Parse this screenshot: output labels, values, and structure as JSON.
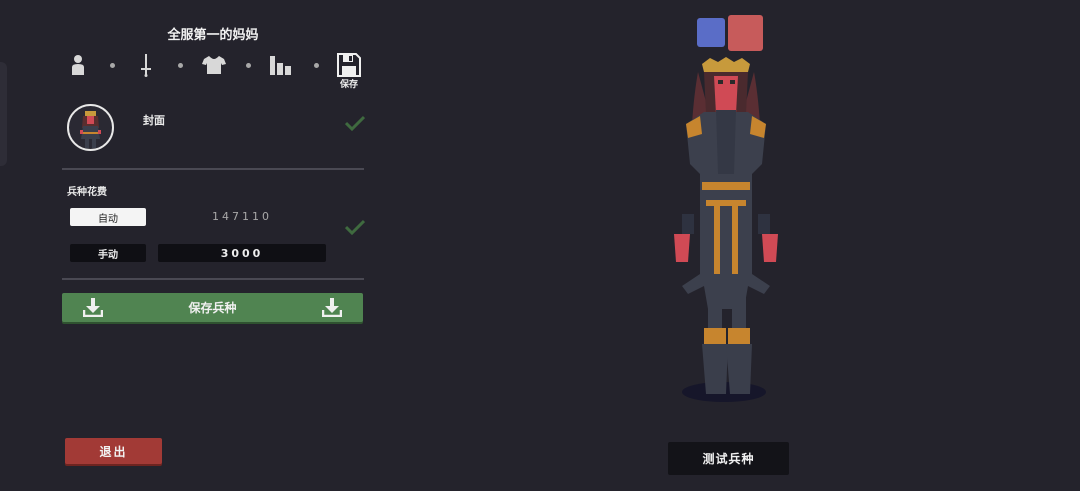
{
  "unit_name": "全服第一的妈妈",
  "editor_tabs": {
    "items": [
      {
        "icon": "person-icon",
        "label": ""
      },
      {
        "icon": "sword-icon",
        "label": ""
      },
      {
        "icon": "shirt-icon",
        "label": ""
      },
      {
        "icon": "stats-bars-icon",
        "label": ""
      },
      {
        "icon": "floppy-disk-icon",
        "label": "保存"
      }
    ],
    "save_label": "保存"
  },
  "cover": {
    "label": "封面",
    "checked": true
  },
  "cost": {
    "section_label": "兵种花费",
    "auto_label": "自动",
    "auto_value": "147110",
    "manual_label": "手动",
    "manual_value": "3000",
    "mode": "manual"
  },
  "save_unit_label": "保存兵种",
  "exit_label": "退出",
  "test_unit_label": "测试兵种",
  "team_colors": {
    "blue": "#5a6dc7",
    "red": "#c75b5b",
    "selected": "red"
  },
  "theme": {
    "accent_green": "#508451",
    "exit_red": "#a23a36",
    "check_green": "#3f6a3f"
  }
}
